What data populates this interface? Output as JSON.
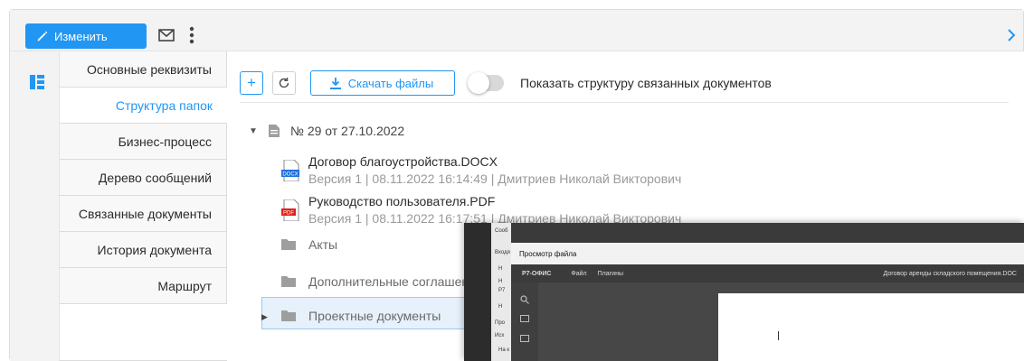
{
  "toolbar": {
    "edit_label": "Изменить"
  },
  "tabs": [
    {
      "label": "Основные реквизиты",
      "active": false
    },
    {
      "label": "Структура папок",
      "active": true
    },
    {
      "label": "Бизнес-процесс",
      "active": false
    },
    {
      "label": "Дерево сообщений",
      "active": false
    },
    {
      "label": "Связанные документы",
      "active": false
    },
    {
      "label": "История документа",
      "active": false
    },
    {
      "label": "Маршрут",
      "active": false
    }
  ],
  "main": {
    "download_label": "Скачать файлы",
    "toggle_label": "Показать структуру связанных документов",
    "toggle_on": false,
    "document_title": "№ 29 от 27.10.2022",
    "files": [
      {
        "name": "Договор благоустройства.DOCX",
        "meta": "Версия 1  |  08.11.2022 16:14:49  |  Дмитриев Николай Викторович",
        "type": "DOCX",
        "icon": "docx-file-icon"
      },
      {
        "name": "Руководство пользователя.PDF",
        "meta": "Версия 1  |  08.11.2022 16:17:51  |  Дмитриев Николай Викторович",
        "type": "PDF",
        "icon": "pdf-file-icon"
      }
    ],
    "folders": [
      {
        "name": "Акты"
      },
      {
        "name": "Дополнительные соглашения"
      },
      {
        "name": "Проектные документы",
        "selected": true
      }
    ]
  },
  "overlay": {
    "title": "Просмотр файла",
    "app_name": "Р7-ОФИС",
    "menu_file": "Файл",
    "menu_plugins": "Плагины",
    "doc_name": "Договор аренды складского помещения.DOC",
    "side_fragments": [
      "Сооб",
      "Входя",
      "Н",
      "Н",
      "Р7",
      "Н",
      "Про",
      "Исх",
      "На к"
    ]
  },
  "colors": {
    "accent": "#2196f3",
    "selected_bg": "#e6f1fb"
  }
}
